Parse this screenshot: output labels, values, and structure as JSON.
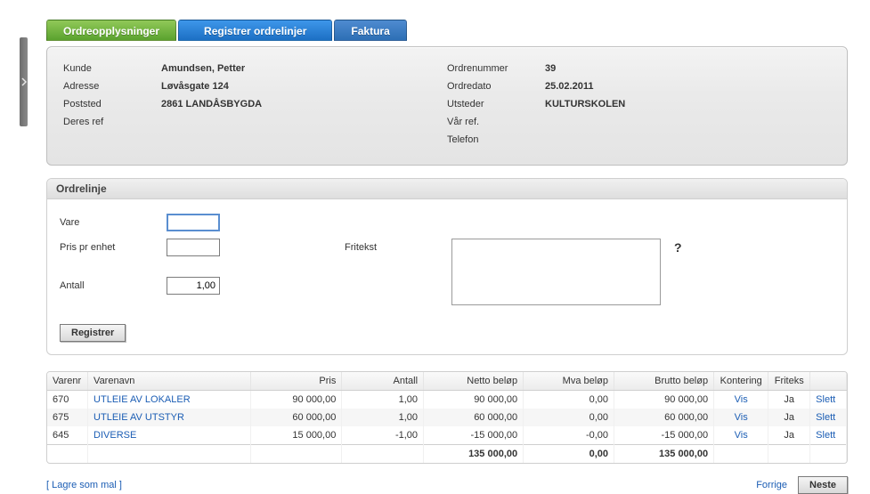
{
  "tabs": {
    "t1": "Ordreopplysninger",
    "t2": "Registrer ordrelinjer",
    "t3": "Faktura"
  },
  "info": {
    "left": {
      "kunde_label": "Kunde",
      "kunde_value": "Amundsen, Petter",
      "adresse_label": "Adresse",
      "adresse_value": "Løvåsgate 124",
      "poststed_label": "Poststed",
      "poststed_value": "2861 LANDÅSBYGDA",
      "deresref_label": "Deres ref",
      "deresref_value": ""
    },
    "right": {
      "ordrenr_label": "Ordrenummer",
      "ordrenr_value": "39",
      "ordredato_label": "Ordredato",
      "ordredato_value": "25.02.2011",
      "utsteder_label": "Utsteder",
      "utsteder_value": "KULTURSKOLEN",
      "varref_label": "Vår ref.",
      "varref_value": "",
      "telefon_label": "Telefon",
      "telefon_value": ""
    }
  },
  "ordrelinje": {
    "header": "Ordrelinje",
    "vare_label": "Vare",
    "pris_label": "Pris pr enhet",
    "antall_label": "Antall",
    "antall_value": "1,00",
    "fritekst_label": "Fritekst",
    "qmark": "?",
    "registrer_btn": "Registrer"
  },
  "grid": {
    "headers": {
      "varenr": "Varenr",
      "varenavn": "Varenavn",
      "pris": "Pris",
      "antall": "Antall",
      "netto": "Netto beløp",
      "mva": "Mva beløp",
      "brutto": "Brutto beløp",
      "kontering": "Kontering",
      "friteks": "Friteks"
    },
    "rows": [
      {
        "varenr": "670",
        "varenavn": "UTLEIE AV LOKALER",
        "pris": "90 000,00",
        "antall": "1,00",
        "netto": "90 000,00",
        "mva": "0,00",
        "brutto": "90 000,00",
        "kontering": "Vis",
        "friteks": "Ja",
        "slett": "Slett"
      },
      {
        "varenr": "675",
        "varenavn": "UTLEIE AV UTSTYR",
        "pris": "60 000,00",
        "antall": "1,00",
        "netto": "60 000,00",
        "mva": "0,00",
        "brutto": "60 000,00",
        "kontering": "Vis",
        "friteks": "Ja",
        "slett": "Slett"
      },
      {
        "varenr": "645",
        "varenavn": "DIVERSE",
        "pris": "15 000,00",
        "antall": "-1,00",
        "netto": "-15 000,00",
        "mva": "-0,00",
        "brutto": "-15 000,00",
        "kontering": "Vis",
        "friteks": "Ja",
        "slett": "Slett"
      }
    ],
    "totals": {
      "netto": "135 000,00",
      "mva": "0,00",
      "brutto": "135 000,00"
    }
  },
  "footer": {
    "lagre_mal": "[ Lagre som mal ]",
    "forrige": "Forrige",
    "neste": "Neste"
  }
}
